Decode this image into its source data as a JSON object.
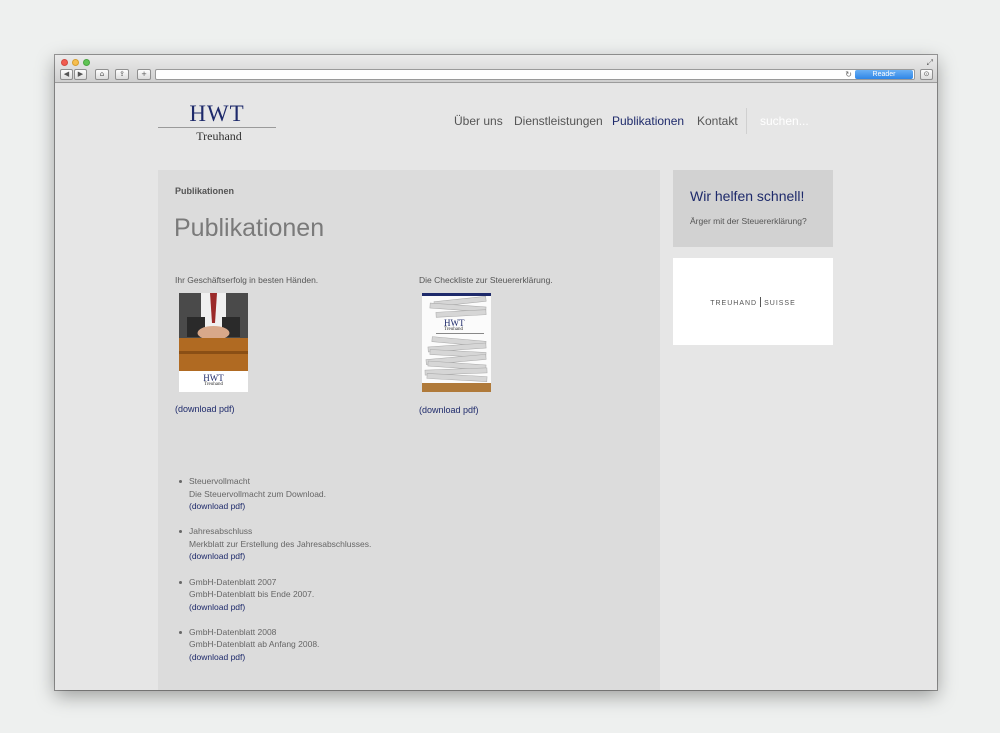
{
  "browser": {
    "reader_label": "Reader",
    "back_glyph": "◀",
    "forward_glyph": "▶",
    "home_glyph": "⌂",
    "share_glyph": "⇪",
    "add_glyph": "+",
    "reload_glyph": "↻",
    "download_glyph": "⊙",
    "resize_glyph": "⤢"
  },
  "logo": {
    "main": "HWT",
    "sub": "Treuhand"
  },
  "nav": {
    "items": [
      {
        "label": "Über uns"
      },
      {
        "label": "Dienstleistungen"
      },
      {
        "label": "Publikationen",
        "active": true
      },
      {
        "label": "Kontakt"
      }
    ],
    "search_placeholder": "suchen..."
  },
  "main": {
    "breadcrumb": "Publikationen",
    "title": "Publikationen",
    "publications": [
      {
        "caption": "Ihr Geschäftserfolg in besten Händen.",
        "link": "(download pdf)",
        "cover_title": "HWT",
        "cover_sub": "Treuhand"
      },
      {
        "caption": "Die Checkliste zur Steuererklärung.",
        "link": "(download pdf)",
        "cover_title": "HWT",
        "cover_sub": "Treuhand"
      }
    ],
    "documents": [
      {
        "title": "Steuervollmacht",
        "desc": "Die Steuervollmacht zum Download.",
        "link": "(download pdf)"
      },
      {
        "title": "Jahresabschluss",
        "desc": "Merkblatt zur Erstellung des Jahresabschlusses.",
        "link": "(download pdf)"
      },
      {
        "title": "GmbH-Datenblatt 2007",
        "desc": "GmbH-Datenblatt bis Ende 2007.",
        "link": "(download pdf)"
      },
      {
        "title": "GmbH-Datenblatt 2008",
        "desc": "GmbH-Datenblatt ab Anfang 2008.",
        "link": "(download pdf)"
      }
    ]
  },
  "sidebar": {
    "heading": "Wir helfen schnell!",
    "text": "Ärger mit der Steuererklärung?",
    "partner_left": "TREUHAND",
    "partner_right": "SUISSE"
  },
  "colors": {
    "brand": "#1e2a6b",
    "page_bg": "#e6e6e6",
    "content_bg": "#dcdcdc"
  }
}
